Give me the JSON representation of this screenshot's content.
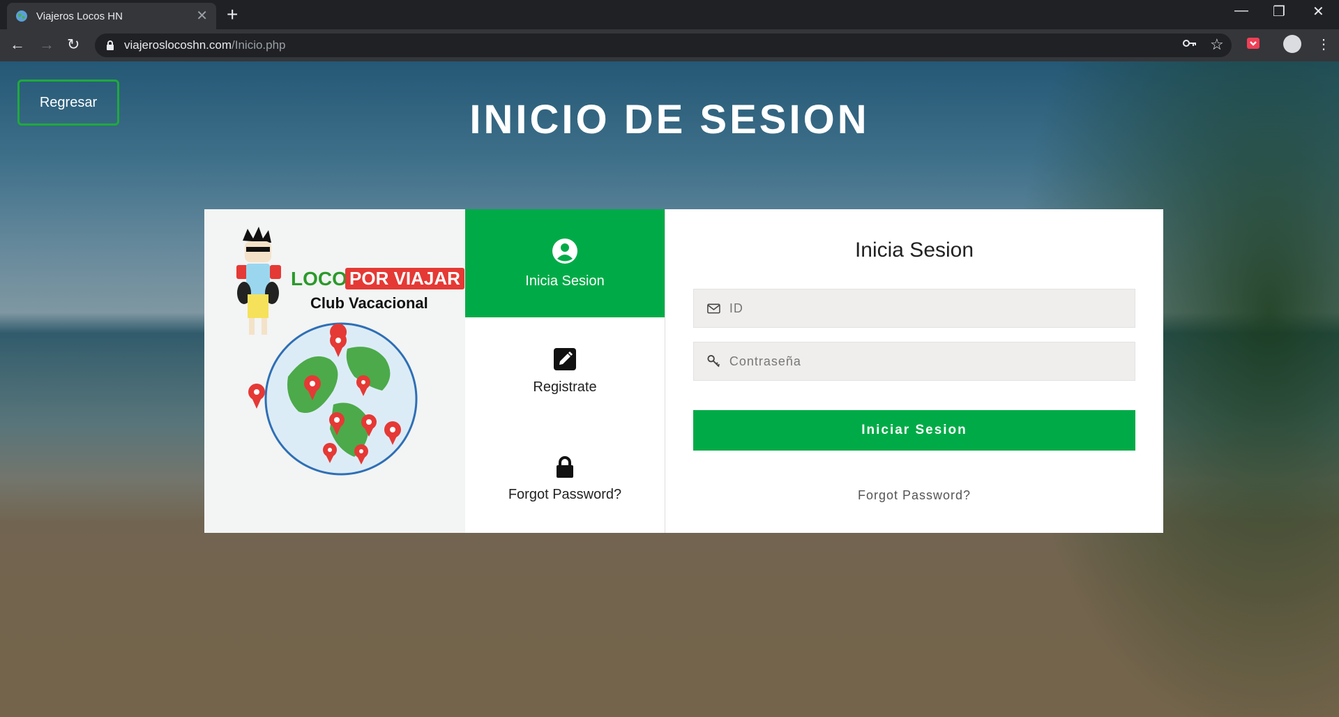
{
  "browser": {
    "tab_title": "Viajeros Locos HN",
    "url_host": "viajeroslocoshn.com",
    "url_path": "/Inicio.php"
  },
  "page": {
    "back_label": "Regresar",
    "title": "INICIO DE SESION"
  },
  "logo": {
    "word_locos": "LOCOS",
    "word_por_viajar": "POR VIAJAR",
    "subtitle": "Club Vacacional"
  },
  "side_tabs": [
    {
      "label": "Inicia Sesion",
      "icon": "user-circle-icon",
      "active": true
    },
    {
      "label": "Registrate",
      "icon": "edit-icon",
      "active": false
    },
    {
      "label": "Forgot Password?",
      "icon": "lock-icon",
      "active": false
    }
  ],
  "form": {
    "title": "Inicia Sesion",
    "id_placeholder": "ID",
    "password_placeholder": "Contraseña",
    "submit_label": "Iniciar Sesion",
    "forgot_label": "Forgot Password?"
  },
  "colors": {
    "accent": "#00ab47",
    "back_border": "#1faa3c"
  }
}
